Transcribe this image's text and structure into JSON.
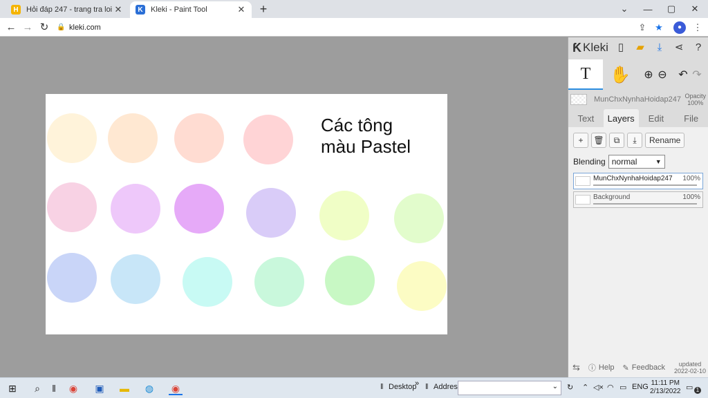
{
  "browser": {
    "tabs": [
      {
        "title": "Hỏi đáp 247 - trang tra loi",
        "favicon": "H",
        "active": false
      },
      {
        "title": "Kleki - Paint Tool",
        "favicon": "K",
        "active": true
      }
    ],
    "new_tab_icon": "+",
    "url": "kleki.com",
    "window_controls": {
      "dropdown": "⌄",
      "minimize": "—",
      "maximize": "▢",
      "close": "✕"
    }
  },
  "canvas": {
    "background": "#ffffff",
    "text_line1": "Các tông",
    "text_line2": "màu Pastel",
    "circles": [
      {
        "color": "#fff3da"
      },
      {
        "color": "#ffe8d2"
      },
      {
        "color": "#ffdcd2"
      },
      {
        "color": "#ffd4d6"
      },
      {
        "color": "#f8d2e4"
      },
      {
        "color": "#eec8fa"
      },
      {
        "color": "#e6aaf8"
      },
      {
        "color": "#d9ccf8"
      },
      {
        "color": "#f0fec6"
      },
      {
        "color": "#e2fccc"
      },
      {
        "color": "#c9d5f8"
      },
      {
        "color": "#c8e6f8"
      },
      {
        "color": "#c8faf4"
      },
      {
        "color": "#c9f8dc"
      },
      {
        "color": "#c8f8c4"
      },
      {
        "color": "#fcfcc4"
      }
    ]
  },
  "panel": {
    "logo": "Kleki",
    "current_layer": "MunChxNynhaHoidap247",
    "opacity_label": "Opacity",
    "opacity_value": "100%",
    "tabs": [
      "Text",
      "Layers",
      "Edit",
      "File"
    ],
    "active_tab": "Layers",
    "rename_label": "Rename",
    "blending_label": "Blending",
    "blending_value": "normal",
    "layers": [
      {
        "name": "MunChxNynhaHoidap247",
        "opacity": "100%",
        "opacity_fraction": 1.0,
        "selected": true
      },
      {
        "name": "Background",
        "opacity": "100%",
        "opacity_fraction": 1.0,
        "selected": false
      }
    ],
    "help_label": "Help",
    "feedback_label": "Feedback",
    "updated_label": "updated",
    "updated_date": "2022-02-10"
  },
  "taskbar": {
    "desktop_label": "Desktop",
    "address_label": "Address",
    "chevrons": "»",
    "lang": "ENG",
    "time": "11:11 PM",
    "date": "2/13/2022",
    "notification_count": "1"
  }
}
